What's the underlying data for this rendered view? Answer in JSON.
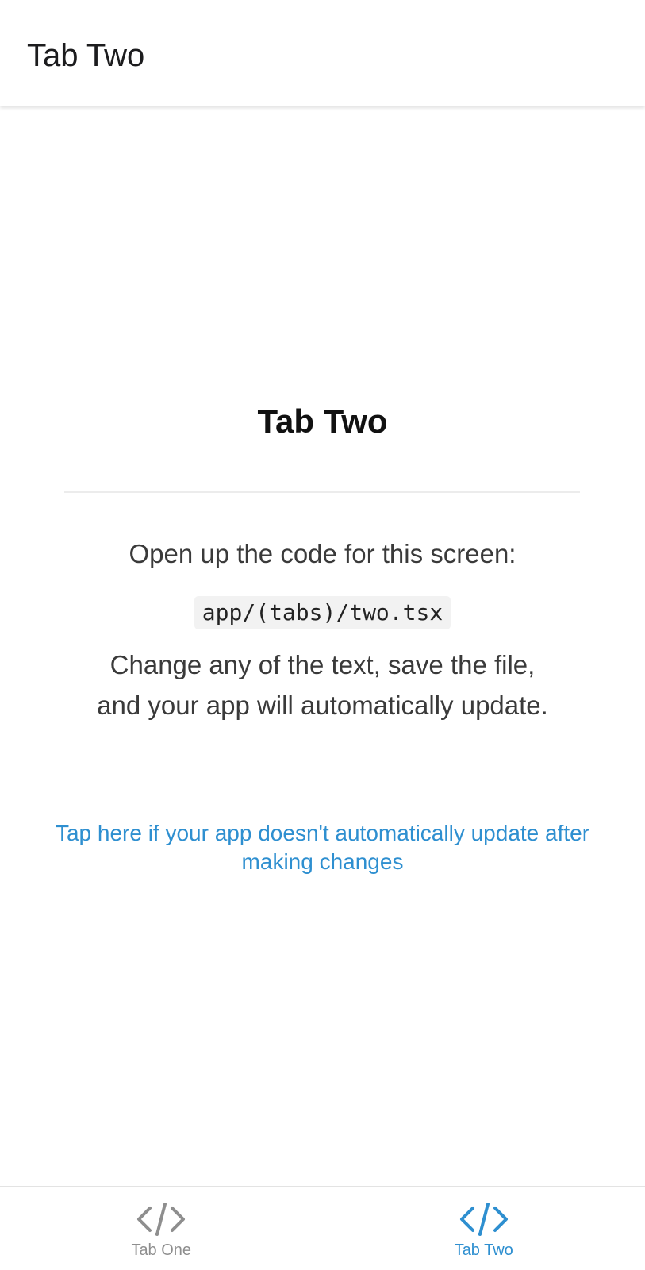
{
  "header": {
    "title": "Tab Two"
  },
  "main": {
    "title": "Tab Two",
    "intro": "Open up the code for this screen:",
    "code_path": "app/(tabs)/two.tsx",
    "description": "Change any of the text, save the file, and your app will automatically update.",
    "help_link": "Tap here if your app doesn't automatically update after making changes"
  },
  "tabbar": {
    "tabs": [
      {
        "label": "Tab One",
        "icon": "code-icon",
        "active": false
      },
      {
        "label": "Tab Two",
        "icon": "code-icon",
        "active": true
      }
    ]
  },
  "colors": {
    "accent": "#2e8fd0",
    "inactive": "#8e8e8e",
    "text": "#3a3a3a",
    "heading": "#111111"
  }
}
